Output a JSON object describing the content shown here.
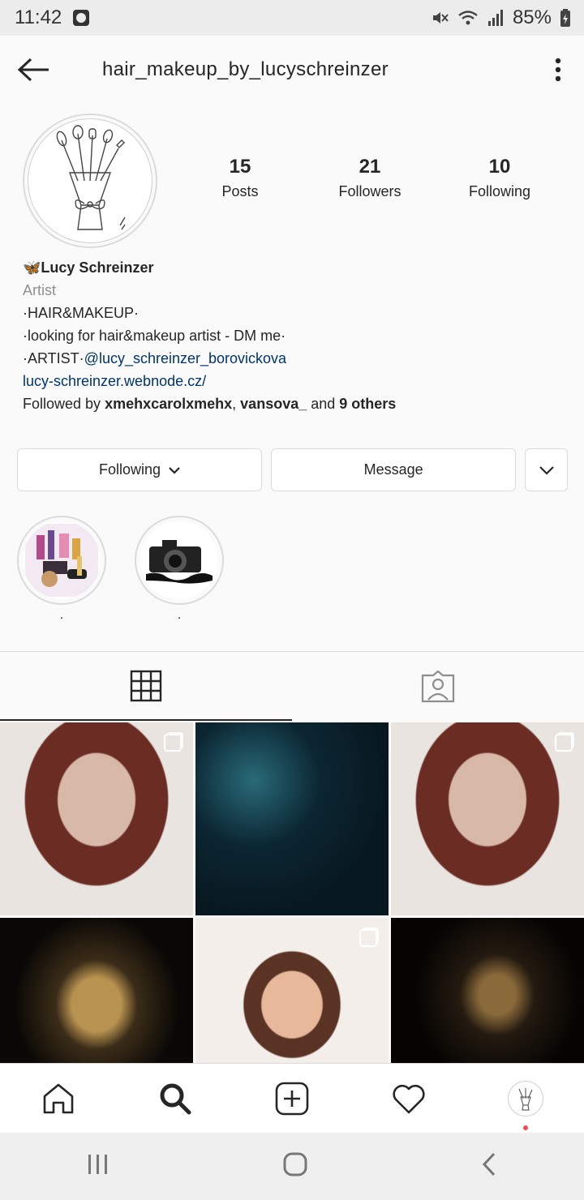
{
  "status_bar": {
    "time": "11:42",
    "battery": "85%",
    "icons": [
      "clock-icon",
      "mute-icon",
      "wifi-icon",
      "signal-icon",
      "battery-icon"
    ]
  },
  "header": {
    "username": "hair_makeup_by_lucyschreinzer",
    "icons": [
      "back-arrow-icon",
      "more-vertical-icon"
    ]
  },
  "profile": {
    "avatar_icon": "makeup-brush-bouquet-illustration",
    "stats": [
      {
        "value": "15",
        "label": "Posts"
      },
      {
        "value": "21",
        "label": "Followers"
      },
      {
        "value": "10",
        "label": "Following"
      }
    ],
    "name_emoji": "🦋",
    "name": "Lucy Schreinzer",
    "category": "Artist",
    "bio_line1": "·HAIR&MAKEUP·",
    "bio_line2": "·looking for hair&makeup artist - DM me·",
    "bio_line3_prefix": "·ARTIST·",
    "bio_line3_mention": "@lucy_schreinzer_borovickova",
    "website": "lucy-schreinzer.webnode.cz/",
    "followed_by_prefix": "Followed by ",
    "followed_by_user1": "xmehxcarolxmehx",
    "followed_by_sep": ", ",
    "followed_by_user2": "vansova_",
    "followed_by_and": " and ",
    "followed_by_others": "9 others"
  },
  "actions": {
    "following_label": "Following",
    "message_label": "Message"
  },
  "highlights": [
    {
      "label": ".",
      "icon": "cosmetics-icon"
    },
    {
      "label": ".",
      "icon": "camera-icon"
    }
  ],
  "tabs": [
    {
      "name": "grid",
      "icon": "grid-icon",
      "active": true
    },
    {
      "name": "tagged",
      "icon": "tagged-person-icon",
      "active": false
    }
  ],
  "posts": [
    {
      "subject": "portrait",
      "multi": true
    },
    {
      "subject": "ocean",
      "multi": false
    },
    {
      "subject": "portrait",
      "multi": true
    },
    {
      "subject": "crown",
      "multi": false
    },
    {
      "subject": "portrait",
      "multi": true
    },
    {
      "subject": "crown",
      "multi": false
    }
  ],
  "bottom_nav": [
    "home-icon",
    "search-icon",
    "add-post-icon",
    "heart-icon",
    "profile-avatar"
  ],
  "colors": {
    "link": "#003569",
    "notification_dot": "#ed4956",
    "border": "#dbdbdb"
  }
}
